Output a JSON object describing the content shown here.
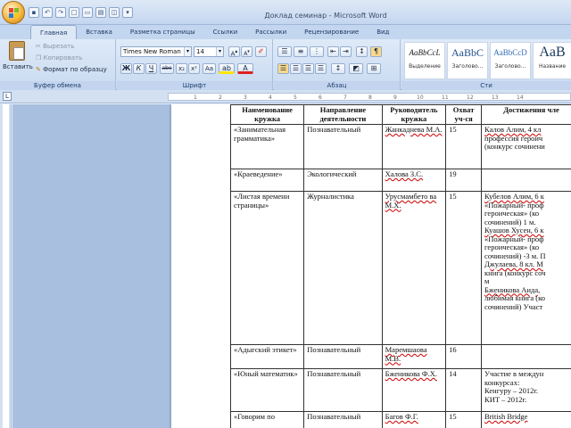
{
  "window": {
    "title": "Доклад семинар - Microsoft Word"
  },
  "quick_access": {
    "buttons": [
      "save-icon",
      "undo-icon",
      "redo-icon",
      "new-icon",
      "open-icon",
      "print-icon",
      "preview-icon",
      "dropdown-icon"
    ]
  },
  "ribbon": {
    "tabs": [
      {
        "label": "Главная",
        "active": true
      },
      {
        "label": "Вставка"
      },
      {
        "label": "Разметка страницы"
      },
      {
        "label": "Ссылки"
      },
      {
        "label": "Рассылки"
      },
      {
        "label": "Рецензирование"
      },
      {
        "label": "Вид"
      }
    ],
    "clipboard": {
      "paste": "Вставить",
      "cut": "Вырезать",
      "copy": "Копировать",
      "format_painter": "Формат по образцу",
      "group_label": "Буфер обмена"
    },
    "font": {
      "name": "Times New Roman",
      "size": "14",
      "group_label": "Шрифт",
      "buttons": [
        "Ж",
        "К",
        "Ч",
        "abe",
        "x₂",
        "x²",
        "Aa",
        "A"
      ]
    },
    "paragraph": {
      "group_label": "Абзац"
    },
    "styles": {
      "items": [
        {
          "sample": "AaBbCcL",
          "name": "Выделение"
        },
        {
          "sample": "AaBbC",
          "name": "Заголово..."
        },
        {
          "sample": "AaBbCcD",
          "name": "Заголово..."
        },
        {
          "sample": "AaB",
          "name": "Название"
        }
      ],
      "group_label": "Сти"
    }
  },
  "ruler": {
    "ticks": [
      "1",
      "2",
      "3",
      "4",
      "5",
      "6",
      "7",
      "8",
      "9",
      "10",
      "11",
      "12",
      "13",
      "14"
    ]
  },
  "document": {
    "headers": [
      "Наименование кружка",
      "Направление деятельности",
      "Руководитель кружка",
      "Охват уч-ся",
      "Достижения чле"
    ],
    "rows": [
      {
        "name": "«Занимательная грамматика»",
        "direction": "Познавательный",
        "leader": "Жанкаднева М.А.",
        "count": "15",
        "achievements": [
          "Калов Алим, 4 кл",
          "профессия героич",
          "(конкурс сочинени"
        ]
      },
      {
        "name": "«Краеведение»",
        "direction": "Экологический",
        "leader": "Халова З.С.",
        "count": "19",
        "achievements": []
      },
      {
        "name": "«Листая времени страницы»",
        "direction": "Журналистика",
        "leader": "Урусмамбето ва М.Х.",
        "count": "15",
        "achievements": [
          "Кубелов Алим, 6 к",
          "«Пожарный- проф",
          "героическая» (ко",
          "сочинений)  1 м.",
          "Куашов Хусен, 6 к",
          "«Пожарный- проф",
          "героическая» (ко",
          "сочинений) -3 м. П",
          "Джулаева, 8 кл. М",
          "книга (конкурс соч",
          "м",
          " Бженикова Аида,",
          "любимая книга (ко",
          "сочинений) Участ"
        ]
      },
      {
        "name": "«Адыгский этикет»",
        "direction": "Познавательный",
        "leader": "Маремшаова М.В.",
        "count": "16",
        "achievements": []
      },
      {
        "name": "«Юный математик»",
        "direction": "Познавательный",
        "leader": "Бженикова Ф.Х.",
        "count": "14",
        "achievements": [
          "Участие в междун",
          "конкурсах:",
          " Кенгуру – 2012г.",
          "  КИТ – 2012г."
        ]
      },
      {
        "name": "«Говорим по",
        "direction": "Познавательный",
        "leader": "Багов Ф.Г.",
        "count": "15",
        "achievements": [
          "British Bridge"
        ]
      }
    ]
  }
}
